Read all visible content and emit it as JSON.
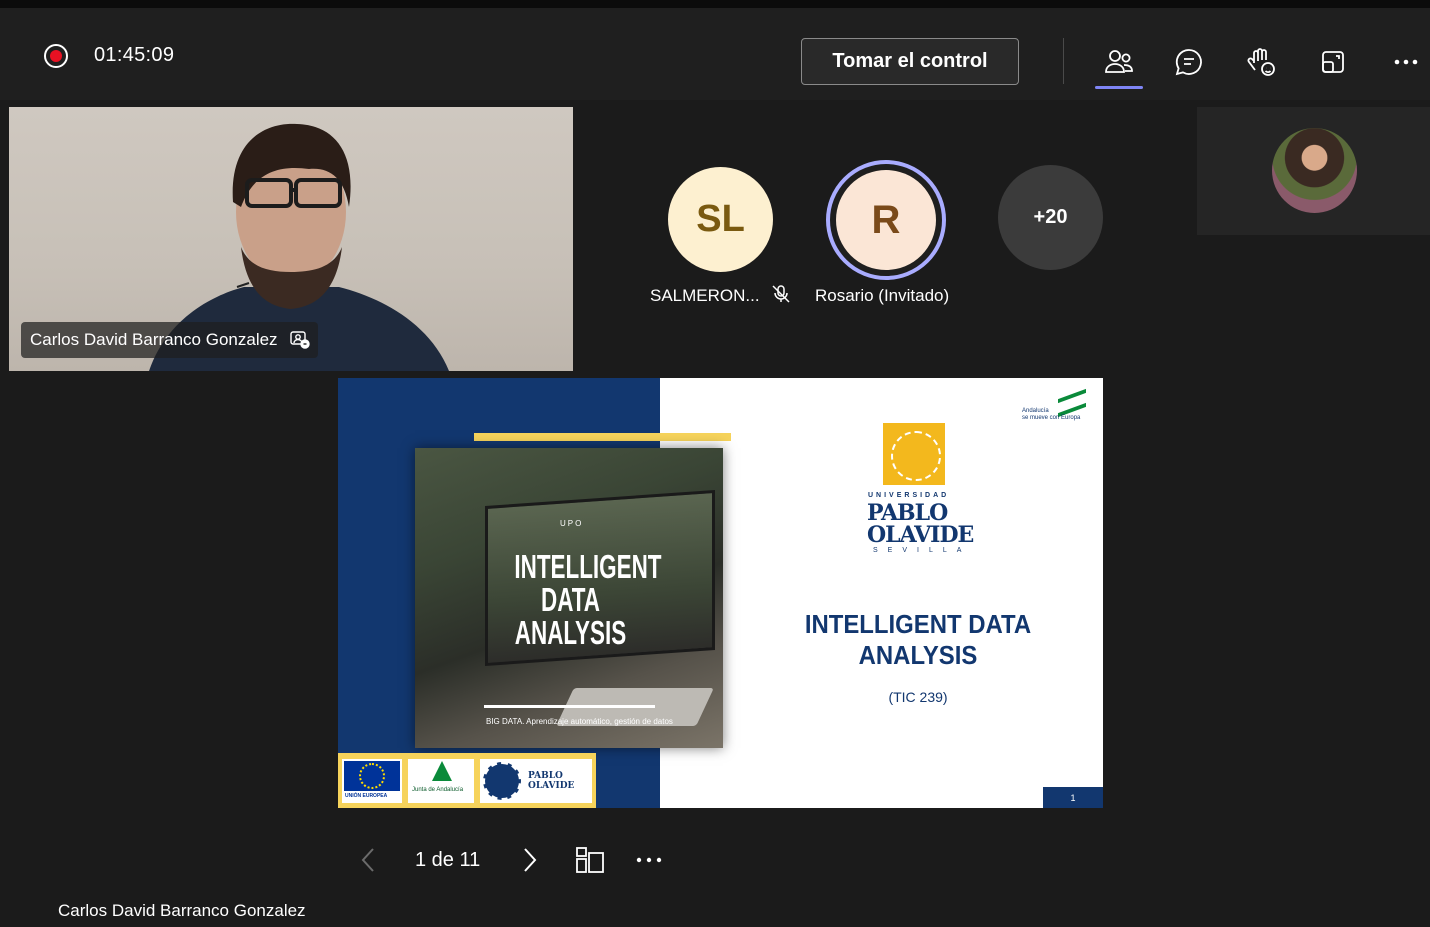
{
  "topbar": {
    "timer": "01:45:09",
    "take_control_label": "Tomar el control",
    "icons": [
      "people-icon",
      "chat-icon",
      "raise-hand-icon",
      "share-tray-icon",
      "more-options-icon"
    ]
  },
  "main_video": {
    "participant_name": "Carlos David Barranco Gonzalez"
  },
  "participants": [
    {
      "initials": "SL",
      "name": "SALMERON...",
      "muted": true,
      "bg": "#fdf0d0",
      "fg": "#7a5a10"
    },
    {
      "initials": "R",
      "name": "Rosario (Invitado)",
      "muted": false,
      "speaking": true,
      "bg": "#fbe6d6",
      "fg": "#7a4a1a"
    },
    {
      "initials": "+20"
    }
  ],
  "slide": {
    "upo_tag": "UPO",
    "left_title": "INTELLIGENT DATA ANALYSIS",
    "left_subtitle": "BIG DATA. Aprendizaje automático, gestión de datos",
    "logos": {
      "eu": "UNIÓN EUROPEA",
      "junta": "Junta de Andalucía",
      "upo_small": "PABLO OLAVIDE"
    },
    "andalucia_text_1": "Andalucía",
    "andalucia_text_2": "se mueve con Europa",
    "university_label": "UNIVERSIDAD",
    "university_name_1": "PABLO",
    "university_name_2": "OLAVIDE",
    "university_city": "SEVILLA",
    "right_title_line1": "INTELLIGENT DATA",
    "right_title_line2": "ANALYSIS",
    "course_code": "(TIC 239)",
    "page_number": "1"
  },
  "pager": {
    "label": "1 de 11"
  },
  "presenter_footer": "Carlos David Barranco Gonzalez",
  "colors": {
    "accent": "#7f85f5",
    "record": "#e81123",
    "slide_blue": "#12376f",
    "slide_yellow": "#f6d35b"
  }
}
